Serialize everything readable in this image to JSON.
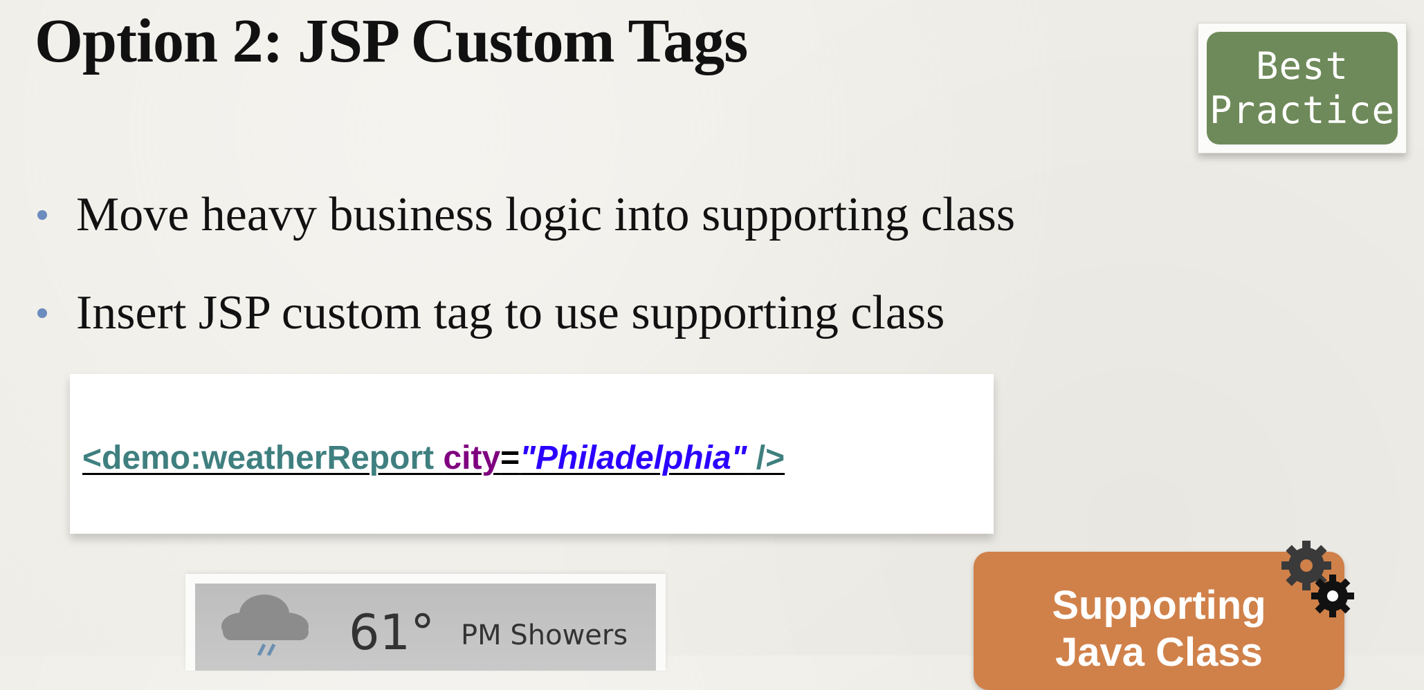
{
  "slide": {
    "title": "Option 2: JSP Custom Tags",
    "badge": {
      "line1": "Best",
      "line2": "Practice",
      "bg_color": "#6f8a5a"
    },
    "bullets": [
      "Move heavy business logic into supporting class",
      "Insert JSP custom tag to use supporting class"
    ],
    "code": {
      "tag_open": "<demo:weatherReport ",
      "attr": "city",
      "eq": "=",
      "value": "\"Philadelphia\"",
      "tag_close": " />"
    },
    "weather": {
      "icon": "rain-cloud-icon",
      "temperature": "61°",
      "condition": "PM Showers"
    },
    "supporting_box": {
      "line1": "Supporting",
      "line2": "Java Class",
      "icon": "gears-icon",
      "bg_color": "#d0814a"
    }
  }
}
